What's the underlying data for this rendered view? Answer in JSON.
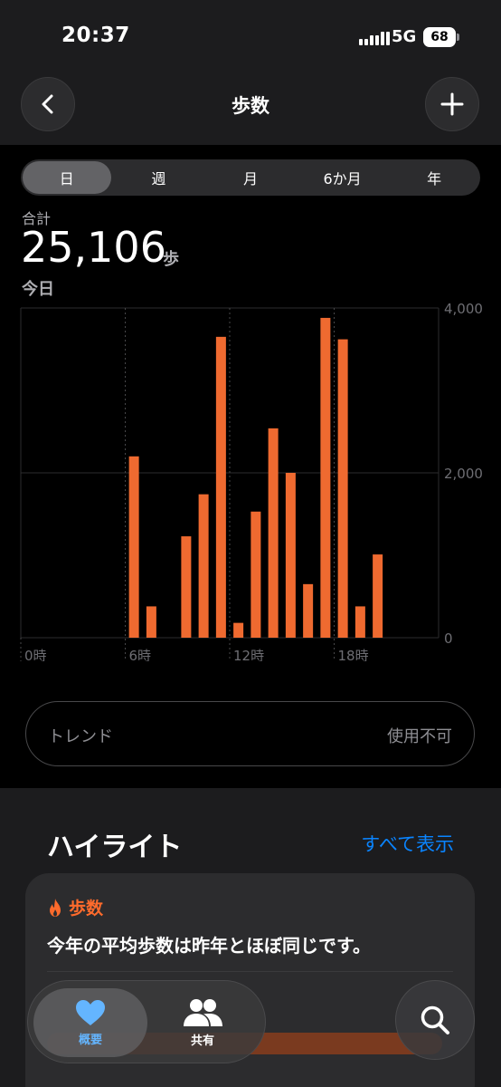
{
  "status_bar": {
    "time": "20:37",
    "network": "5G",
    "battery": "68"
  },
  "header": {
    "title": "歩数",
    "back_icon": "chevron-left-icon",
    "add_icon": "plus-icon"
  },
  "range_tabs": [
    {
      "label": "日",
      "selected": true
    },
    {
      "label": "週",
      "selected": false
    },
    {
      "label": "月",
      "selected": false
    },
    {
      "label": "6か月",
      "selected": false
    },
    {
      "label": "年",
      "selected": false
    }
  ],
  "summary": {
    "total_label": "合計",
    "total_value": "25,106",
    "unit": "歩",
    "date_label": "今日"
  },
  "chart_data": {
    "type": "bar",
    "x": [
      6,
      7,
      9,
      10,
      11,
      12,
      13,
      14,
      15,
      16,
      17,
      18,
      19
    ],
    "values": [
      2200,
      380,
      1230,
      1740,
      3650,
      180,
      1530,
      2540,
      2000,
      650,
      3880,
      3620,
      380,
      1010
    ],
    "hours": [
      6,
      7,
      9,
      10,
      11,
      12,
      13,
      14,
      15,
      16,
      17,
      18,
      19,
      20
    ],
    "x_ticks": [
      "0時",
      "6時",
      "12時",
      "18時"
    ],
    "y_ticks": [
      "0",
      "2,000",
      "4,000"
    ],
    "ylim": [
      0,
      4000
    ],
    "bar_color": "#ef6a30",
    "grid": true
  },
  "trend": {
    "label": "トレンド",
    "value": "使用不可"
  },
  "highlights": {
    "title": "ハイライト",
    "show_all": "すべて表示",
    "card": {
      "category": "歩数",
      "category_icon": "flame-icon",
      "text": "今年の平均歩数は昨年とほぼ同じです。"
    }
  },
  "tab_bar": {
    "summary": {
      "label": "概要",
      "icon": "heart-icon"
    },
    "sharing": {
      "label": "共有",
      "icon": "people-icon"
    },
    "search_icon": "search-icon"
  },
  "colors": {
    "accent_blue": "#0a84ff",
    "accent_orange": "#ef6a30"
  }
}
